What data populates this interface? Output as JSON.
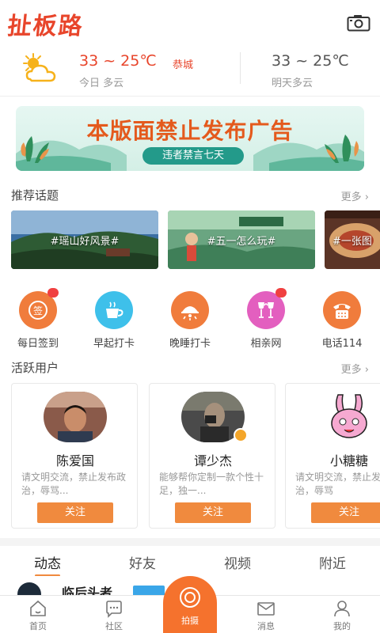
{
  "app": {
    "logo_text": "扯板路"
  },
  "header": {
    "camera_icon": "camera-icon"
  },
  "weather": {
    "today_temp": "33 ~ 25℃",
    "city": "恭城",
    "today_label": "今日 多云",
    "tomorrow_temp": "33 ~ 25℃",
    "tomorrow_label": "明天多云",
    "icon": "partly-cloudy-icon"
  },
  "banner": {
    "title": "本版面禁止发布广告",
    "subtitle": "违者禁言七天"
  },
  "topics": {
    "title": "推荐话题",
    "more": "更多",
    "items": [
      {
        "label": "#瑶山好风景#"
      },
      {
        "label": "#五一怎么玩#"
      },
      {
        "label": "#一张图"
      }
    ]
  },
  "shortcuts": [
    {
      "label": "每日签到",
      "icon": "sign-in-icon",
      "color": "#f07c3c",
      "badge": true
    },
    {
      "label": "早起打卡",
      "icon": "coffee-icon",
      "color": "#3ec0ea",
      "badge": false
    },
    {
      "label": "晚睡打卡",
      "icon": "lamp-icon",
      "color": "#f07c3c",
      "badge": false
    },
    {
      "label": "相亲网",
      "icon": "wine-glasses-icon",
      "color": "#e35fbf",
      "badge": true
    },
    {
      "label": "电话114",
      "icon": "telephone-icon",
      "color": "#f07c3c",
      "badge": false
    }
  ],
  "active_users": {
    "title": "活跃用户",
    "more": "更多",
    "follow_label": "关注",
    "items": [
      {
        "name": "陈爱国",
        "bio": "请文明交流，禁止发布政治，辱骂..."
      },
      {
        "name": "谭少杰",
        "bio": "能够帮你定制一款个性十足，独一..."
      },
      {
        "name": "小糖糖",
        "bio": "请文明交流，禁止发布政治，辱骂"
      }
    ]
  },
  "feed_tabs": [
    "动态",
    "好友",
    "视频",
    "附近"
  ],
  "feed_peek": {
    "name": "临后头者"
  },
  "bottom_nav": {
    "items": [
      {
        "label": "首页",
        "icon": "home-icon"
      },
      {
        "label": "社区",
        "icon": "chat-bubble-icon"
      },
      {
        "label": "拍摄",
        "icon": "capture-icon"
      },
      {
        "label": "消息",
        "icon": "mail-icon"
      },
      {
        "label": "我的",
        "icon": "user-icon"
      }
    ]
  },
  "colors": {
    "brand": "#e8452b",
    "accent": "#f08a3e",
    "nav_center": "#f5722d"
  }
}
